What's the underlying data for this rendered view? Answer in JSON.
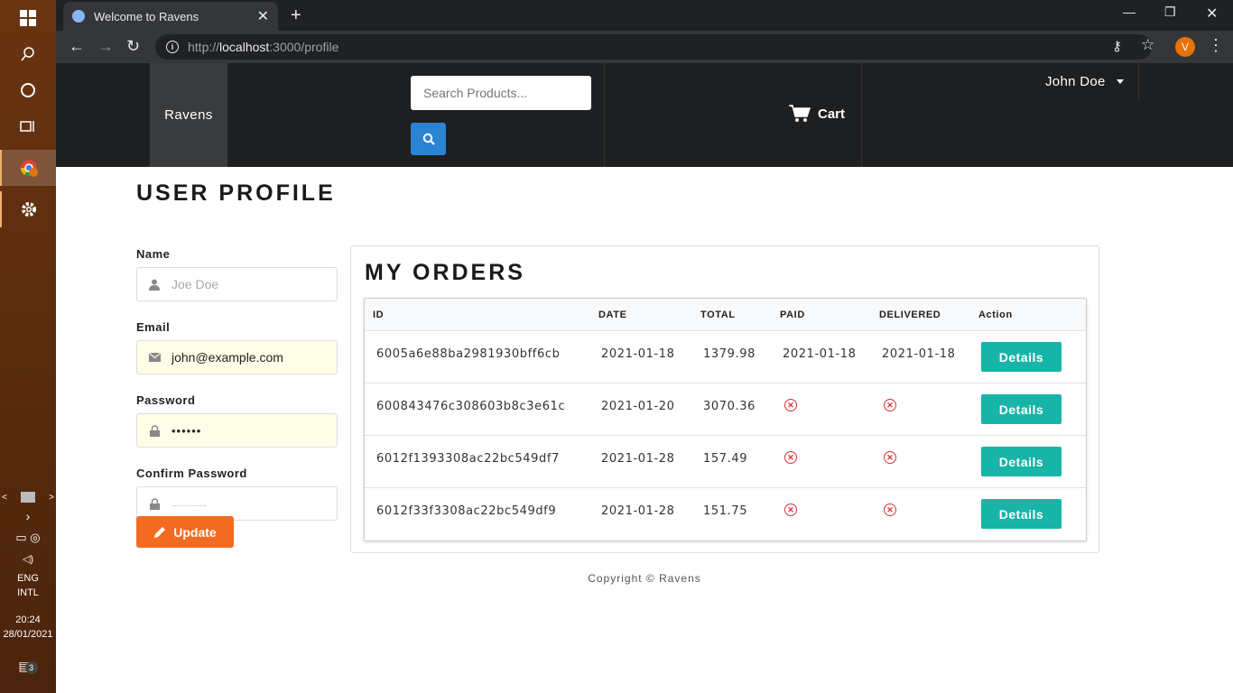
{
  "taskbar": {
    "language": [
      "ENG",
      "INTL"
    ],
    "time": "20:24",
    "date": "28/01/2021",
    "notification_count": "3"
  },
  "browser": {
    "tab_title": "Welcome to Ravens",
    "url_scheme": "http://",
    "url_host": "localhost",
    "url_rest": ":3000/profile",
    "profile_initial": "V"
  },
  "navbar": {
    "brand": "Ravens",
    "search_placeholder": "Search Products...",
    "cart_label": "Cart",
    "user_name": "John Doe"
  },
  "page": {
    "title": "USER PROFILE"
  },
  "form": {
    "name_label": "Name",
    "name_placeholder": "Joe Doe",
    "email_label": "Email",
    "email_value": "john@example.com",
    "password_label": "Password",
    "password_value": "••••••",
    "confirm_label": "Confirm Password",
    "confirm_placeholder": "..............",
    "update_label": "Update"
  },
  "orders": {
    "title": "MY ORDERS",
    "columns": [
      "ID",
      "DATE",
      "TOTAL",
      "PAID",
      "DELIVERED",
      "Action"
    ],
    "rows": [
      {
        "id": "6005a6e88ba2981930bff6cb",
        "date": "2021-01-18",
        "total": "1379.98",
        "paid": "2021-01-18",
        "delivered": "2021-01-18",
        "action": "Details"
      },
      {
        "id": "600843476c308603b8c3e61c",
        "date": "2021-01-20",
        "total": "3070.36",
        "paid": "",
        "delivered": "",
        "action": "Details"
      },
      {
        "id": "6012f1393308ac22bc549df7",
        "date": "2021-01-28",
        "total": "157.49",
        "paid": "",
        "delivered": "",
        "action": "Details"
      },
      {
        "id": "6012f33f3308ac22bc549df9",
        "date": "2021-01-28",
        "total": "151.75",
        "paid": "",
        "delivered": "",
        "action": "Details"
      }
    ]
  },
  "footer": {
    "copyright": "Copyright © Ravens"
  },
  "colors": {
    "accent_orange": "#f26b21",
    "accent_teal": "#17b4a8",
    "search_blue": "#2a84d3",
    "error_red": "#d9323a"
  }
}
